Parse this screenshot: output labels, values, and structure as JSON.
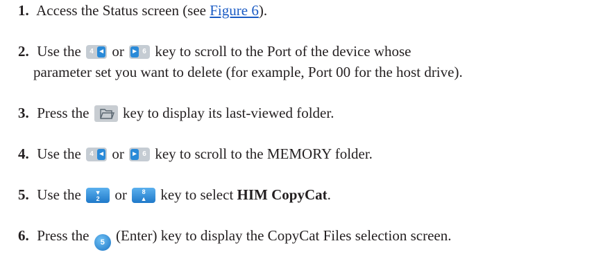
{
  "steps": [
    {
      "num": "1.",
      "before": "Access the Status screen (see ",
      "link": "Figure 6",
      "after": ")."
    },
    {
      "num": "2.",
      "before": "Use the ",
      "or": "or",
      "after": "key to scroll to the Port of the device whose",
      "cont": "parameter set you want to delete (for example, Port 00 for the host drive)."
    },
    {
      "num": "3.",
      "before": "Press the ",
      "after": "key to display its last-viewed folder."
    },
    {
      "num": "4.",
      "before": "Use the ",
      "or": "or",
      "after": "key to scroll to the MEMORY folder."
    },
    {
      "num": "5.",
      "before": "Use the ",
      "or": "or",
      "after": "key to select ",
      "bold": "HIM CopyCat",
      "end": "."
    },
    {
      "num": "6.",
      "before": "Press the ",
      "after": "(Enter) key to display the CopyCat Files selection screen."
    }
  ],
  "keys": {
    "left": {
      "digit": "4",
      "arrow": "◄",
      "icon": "left-arrow-4-key-icon"
    },
    "right": {
      "digit": "6",
      "arrow": "►",
      "icon": "right-arrow-6-key-icon"
    },
    "folder": {
      "icon": "folder-key-icon"
    },
    "down": {
      "digit": "2",
      "arrow": "▼",
      "icon": "down-arrow-2-key-icon"
    },
    "up": {
      "digit": "8",
      "arrow": "▲",
      "icon": "up-arrow-8-key-icon"
    },
    "enter": {
      "digit": "5",
      "icon": "enter-5-key-icon"
    }
  }
}
